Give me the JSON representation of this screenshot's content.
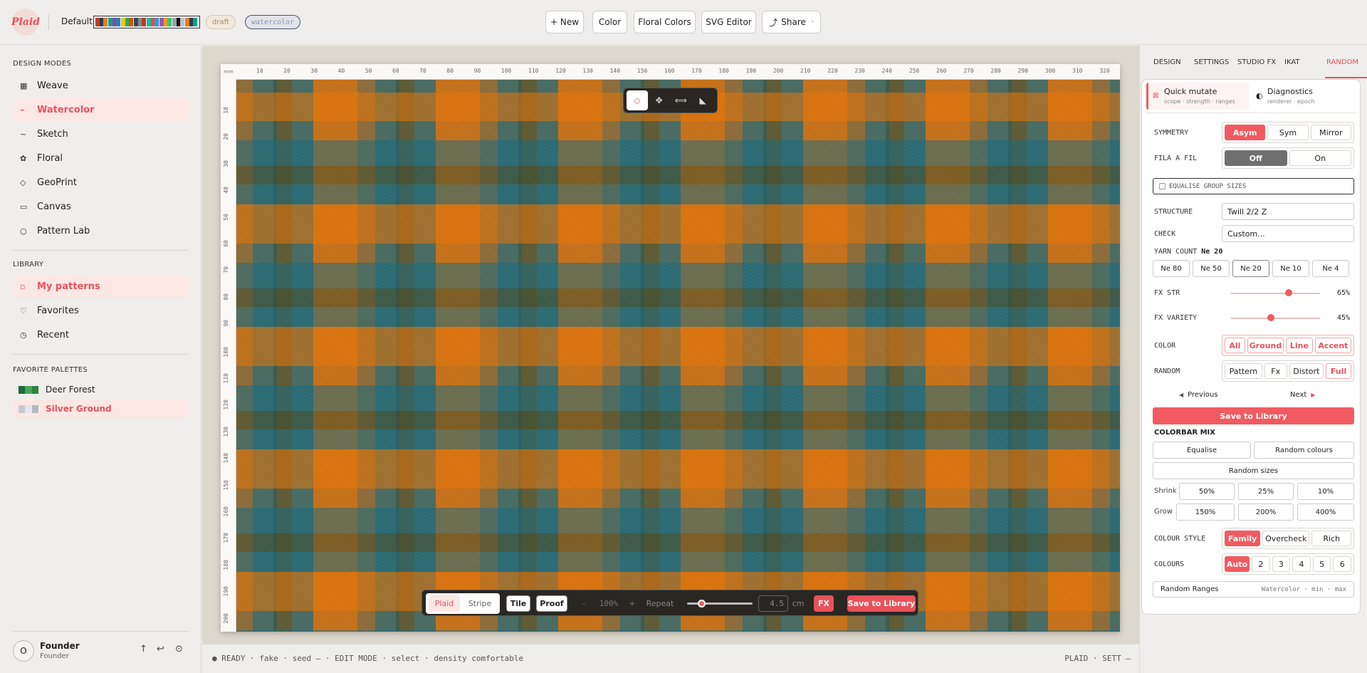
{
  "colors": {
    "accent": "#f15a60",
    "orange": "#e07d1a",
    "teal": "#23708a",
    "olive": "#5b6a3a",
    "khaki": "#8f6f3d"
  },
  "topbar": {
    "logo": "Plaid",
    "project": "Default",
    "chips": [
      "draft",
      "watercolor"
    ],
    "buttons": [
      "+ New",
      "Color",
      "Floral Colors",
      "SVG Editor",
      "Share"
    ],
    "share_suffix": "·"
  },
  "sidebar": {
    "design_modes_title": "DESIGN MODES",
    "modes": [
      {
        "label": "Weave",
        "icon": "grid-icon"
      },
      {
        "label": "Watercolor",
        "icon": "brush-icon"
      },
      {
        "label": "Sketch",
        "icon": "pencil-icon"
      },
      {
        "label": "Floral",
        "icon": "flower-icon"
      },
      {
        "label": "GeoPrint",
        "icon": "diamond-icon"
      },
      {
        "label": "Canvas",
        "icon": "rectangle-icon"
      },
      {
        "label": "Pattern Lab",
        "icon": "circle-icon"
      }
    ],
    "library_title": "LIBRARY",
    "library": [
      {
        "label": "My patterns",
        "icon": "square-icon"
      },
      {
        "label": "Favorites",
        "icon": "heart-icon"
      },
      {
        "label": "Recent",
        "icon": "clock-icon"
      }
    ],
    "palettes_title": "FAVORITE PALETTES",
    "palettes": [
      {
        "label": "Deer Forest",
        "colors": [
          "#1e6b35",
          "#4aa35b",
          "#2c8441"
        ]
      },
      {
        "label": "Silver Ground",
        "colors": [
          "#c9c9d2",
          "#e6e6ec",
          "#b5b7c2"
        ]
      }
    ],
    "user": {
      "initial": "O",
      "name": "Founder",
      "role": "Founder"
    }
  },
  "canvas": {
    "ruler_unit": "mm",
    "ruler_top": [
      "10",
      "20",
      "30",
      "40",
      "50",
      "60",
      "70",
      "80",
      "90",
      "100",
      "110",
      "120",
      "130",
      "140",
      "150",
      "160",
      "170",
      "180",
      "190",
      "200",
      "210",
      "220",
      "230",
      "240",
      "250",
      "260",
      "270",
      "280",
      "290",
      "300",
      "310",
      "320"
    ],
    "ruler_left": [
      "10",
      "20",
      "30",
      "40",
      "50",
      "60",
      "70",
      "80",
      "90",
      "100",
      "110",
      "120",
      "130",
      "140",
      "150",
      "160",
      "170",
      "180",
      "190",
      "200"
    ]
  },
  "bottombar": {
    "plaid": "Plaid",
    "stripe": "Stripe",
    "tile": "Tile",
    "proof": "Proof",
    "minus": "-",
    "zoom": "100%",
    "plus": "+",
    "repeat_label": "Repeat",
    "repeat_value": "4.5",
    "unit": "cm",
    "fx": "FX",
    "save": "Save to Library"
  },
  "status": {
    "left": "● READY · fake · seed — · EDIT MODE · select · density comfortable",
    "right": "PLAID · SETT —"
  },
  "rightpanel": {
    "tabs": [
      "DESIGN",
      "SETTINGS",
      "STUDIO FX",
      "IKAT",
      "RANDOM"
    ],
    "quick_mutate": "Quick mutate",
    "quick_mutate_sub": "scope · strength · ranges",
    "diagnostics": "Diagnostics",
    "diagnostics_sub": "renderer · epoch",
    "symmetry_label": "SYMMETRY",
    "symmetry": [
      "Asym",
      "Sym",
      "Mirror"
    ],
    "fila_label": "FILA A FIL",
    "fila": [
      "Off",
      "On"
    ],
    "equalise": "EQUALISE GROUP SIZES",
    "structure_label": "STRUCTURE",
    "structure": "Twill 2/2 Z",
    "check_label": "CHECK",
    "check": "Custom...",
    "yarn_label": "YARN COUNT",
    "yarn_value": "Ne 20",
    "yarn": [
      "Ne 80",
      "Ne 50",
      "Ne 20",
      "Ne 10",
      "Ne 4"
    ],
    "fx_str_label": "FX STR",
    "fx_str": "65%",
    "fx_str_val": 0.65,
    "fx_var_label": "FX VARIETY",
    "fx_var": "45%",
    "fx_var_val": 0.45,
    "color_label": "COLOR",
    "color": [
      "All",
      "Ground",
      "Line",
      "Accent"
    ],
    "random_label": "RANDOM",
    "random": [
      "Pattern",
      "Fx",
      "Distort",
      "Full"
    ],
    "previous": "Previous",
    "next": "Next",
    "save": "Save to Library",
    "colorbar_mix": "COLORBAR MIX",
    "equalise_btn": "Equalise",
    "random_colours": "Random colours",
    "random_sizes": "Random sizes",
    "shrink_label": "Shrink",
    "shrink": [
      "50%",
      "25%",
      "10%"
    ],
    "grow_label": "Grow",
    "grow": [
      "150%",
      "200%",
      "400%"
    ],
    "colour_style_label": "COLOUR STYLE",
    "colour_style": [
      "Family",
      "Overcheck",
      "Rich"
    ],
    "colours_label": "COLOURS",
    "colours": [
      "Auto",
      "2",
      "3",
      "4",
      "5",
      "6"
    ],
    "random_ranges": "Random Ranges",
    "random_ranges_sub": "Watercolor · min · max"
  }
}
